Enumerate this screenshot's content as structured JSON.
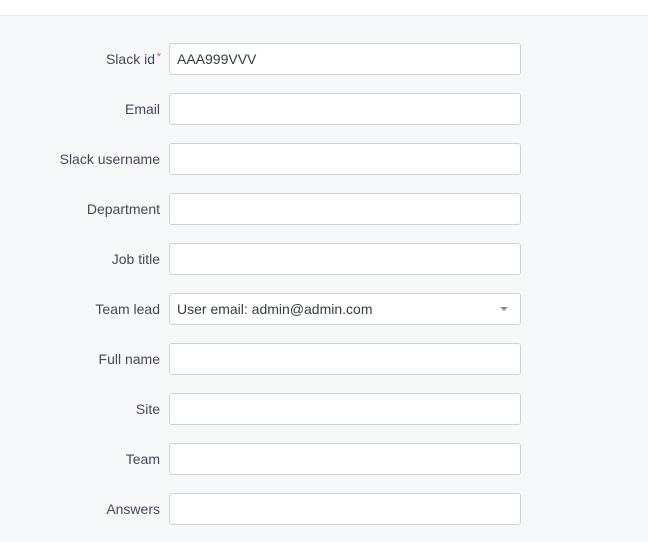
{
  "form": {
    "fields": [
      {
        "label": "Slack id",
        "value": "AAA999VVV",
        "required_mark": "*"
      },
      {
        "label": "Email",
        "value": ""
      },
      {
        "label": "Slack username",
        "value": ""
      },
      {
        "label": "Department",
        "value": ""
      },
      {
        "label": "Job title",
        "value": ""
      },
      {
        "label": "Team lead",
        "value": "User email: admin@admin.com"
      },
      {
        "label": "Full name",
        "value": ""
      },
      {
        "label": "Site",
        "value": ""
      },
      {
        "label": "Team",
        "value": ""
      },
      {
        "label": "Answers",
        "value": ""
      }
    ]
  },
  "colors": {
    "background": "#f7f8fa",
    "required": "#e05260",
    "border": "#cfd3d8"
  },
  "icons": {
    "team_lead_dropdown": "chevron-down-icon"
  }
}
